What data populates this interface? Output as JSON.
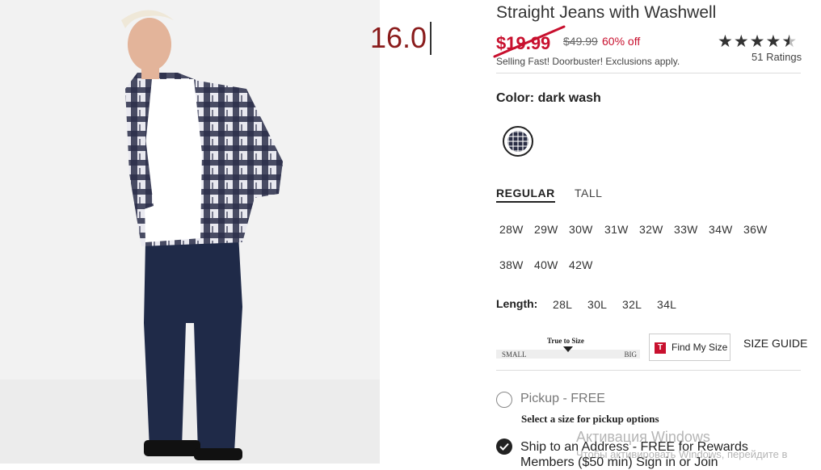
{
  "product": {
    "title": "Straight Jeans with Washwell",
    "price_input_value": "16.0",
    "sale_price": "$19.99",
    "original_price": "$49.99",
    "discount": "60% off",
    "promo": "Selling Fast! Doorbuster! Exclusions apply.",
    "rating_value": 4.5,
    "rating_stars": "★★★★",
    "rating_half": "★",
    "rating_empty": "★",
    "ratings_count": "51 Ratings"
  },
  "color": {
    "label": "Color:",
    "value": "dark wash"
  },
  "fit_tabs": [
    "REGULAR",
    "TALL"
  ],
  "waist_sizes": [
    "28W",
    "29W",
    "30W",
    "31W",
    "32W",
    "33W",
    "34W",
    "36W",
    "38W",
    "40W",
    "42W"
  ],
  "length": {
    "label": "Length:",
    "options": [
      "28L",
      "30L",
      "32L",
      "34L"
    ]
  },
  "fit_meter": {
    "title": "True to Size",
    "small": "SMALL",
    "big": "BIG"
  },
  "find_my_size": {
    "icon_letter": "T",
    "label": "Find My Size"
  },
  "size_guide": "SIZE GUIDE",
  "fulfillment": {
    "pickup_label": "Pickup - FREE",
    "pickup_note": "Select a size for pickup options",
    "ship_label": "Ship to an Address - FREE for Rewards Members ($50 min) Sign in or Join"
  },
  "watermark": {
    "line1": "Активация Windows",
    "line2": "Чтобы активировать Windows, перейдите в"
  },
  "colors": {
    "sale_red": "#c8102e",
    "input_red": "#8a1c1c"
  }
}
